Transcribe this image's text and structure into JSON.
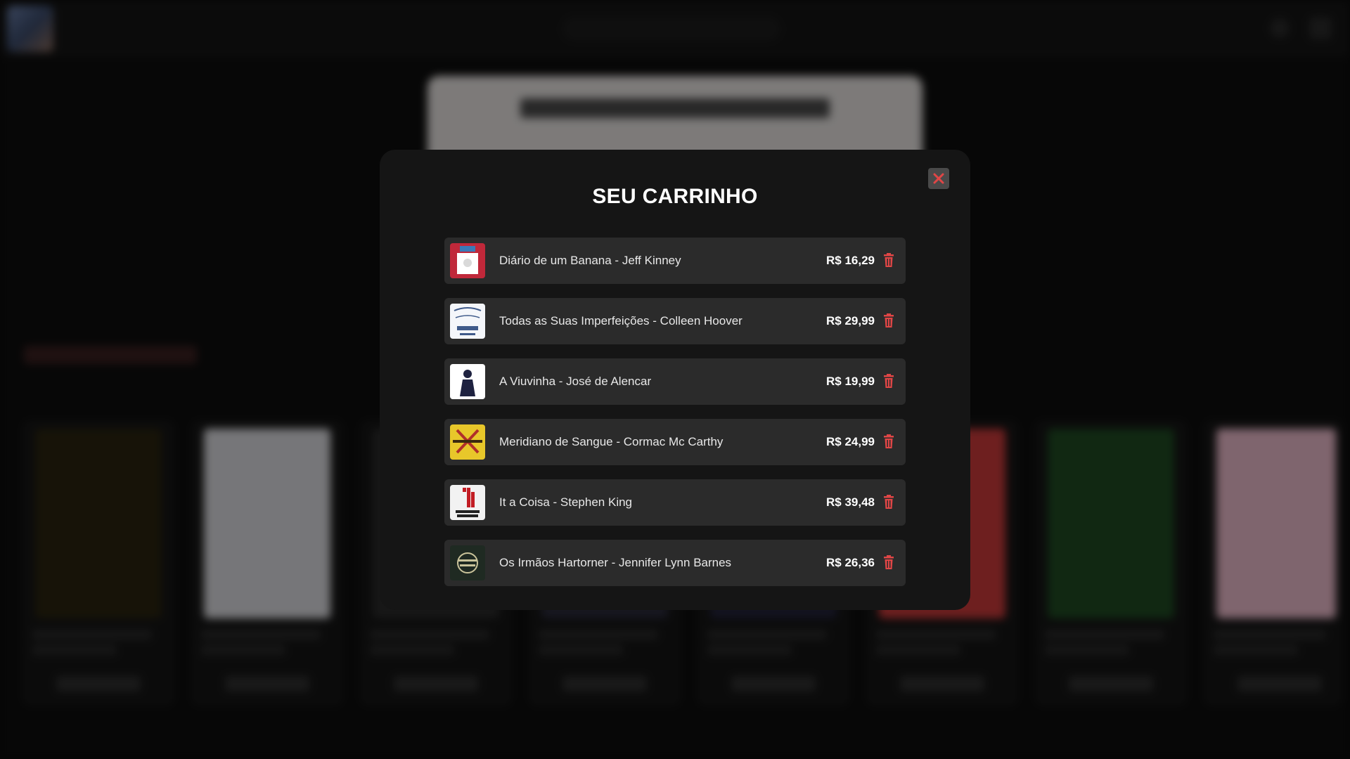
{
  "modal": {
    "title": "SEU CARRINHO",
    "close_icon": "close-x-icon"
  },
  "cart": {
    "items": [
      {
        "title": "Diário de um Banana - Jeff Kinney",
        "price": "R$ 16,29",
        "cover_colors": [
          "#c0283a",
          "#ffffff"
        ]
      },
      {
        "title": "Todas as Suas Imperfeições - Colleen Hoover",
        "price": "R$ 29,99",
        "cover_colors": [
          "#f4f6fa",
          "#3f5a8a"
        ]
      },
      {
        "title": "A Viuvinha - José de Alencar",
        "price": "R$ 19,99",
        "cover_colors": [
          "#ffffff",
          "#1e2240"
        ]
      },
      {
        "title": "Meridiano de Sangue - Cormac Mc Carthy",
        "price": "R$ 24,99",
        "cover_colors": [
          "#e8c72a",
          "#b0302a"
        ]
      },
      {
        "title": "It a Coisa - Stephen King",
        "price": "R$ 39,48",
        "cover_colors": [
          "#f2f2f2",
          "#c21d24"
        ]
      },
      {
        "title": "Os Irmãos Hartorner - Jennifer Lynn Barnes",
        "price": "R$ 26,36",
        "cover_colors": [
          "#1f2a22",
          "#c9c39a"
        ]
      }
    ],
    "trash_icon": "trash-icon"
  },
  "colors": {
    "accent_red": "#e04646",
    "modal_bg": "#151515",
    "item_bg": "#2b2b2b"
  }
}
